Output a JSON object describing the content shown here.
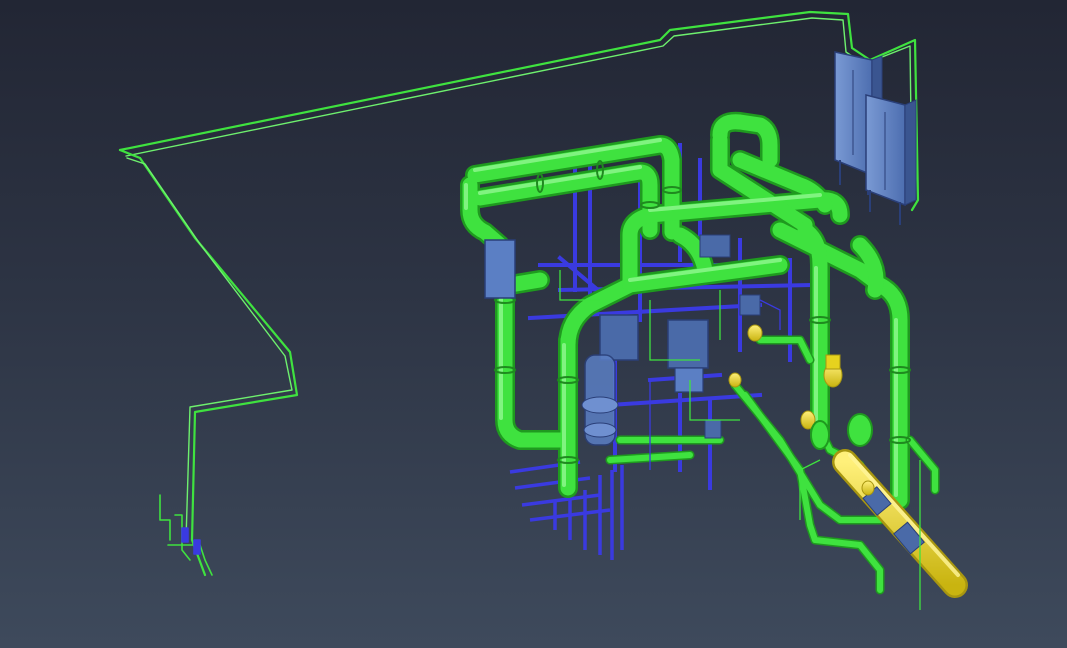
{
  "viewport": {
    "background_top": "#222634",
    "background_bottom": "#3e4a5c"
  },
  "scene": {
    "kind": "3d-piping-model",
    "colors": {
      "pipe": "#3fe23f",
      "pipe_highlight": "#8cf78c",
      "pipe_shadow": "#1f9a1f",
      "steel": "#3a3ae0",
      "cabinet": "#5b7fc4",
      "cabinet_dark": "#3a5590",
      "equipment": "#4a6aa8",
      "valve": "#e6d21e"
    },
    "components": [
      "trace-line",
      "electrical-cabinet",
      "main-pipe-header",
      "support-steel",
      "vertical-pumps",
      "yellow-valve-assembly"
    ]
  }
}
